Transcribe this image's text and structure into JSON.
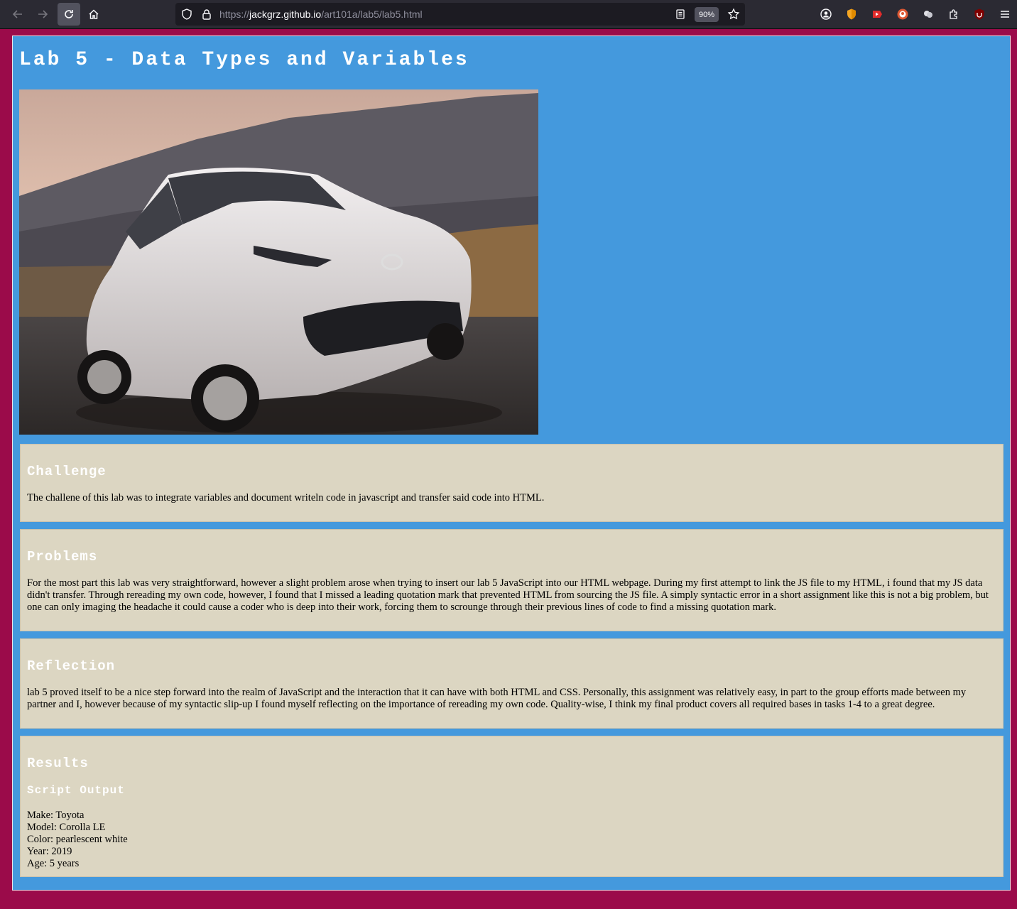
{
  "browser": {
    "url_scheme": "https://",
    "url_host": "jackgrz.github.io",
    "url_path": "/art101a/lab5/lab5.html",
    "zoom": "90%"
  },
  "page": {
    "title": "Lab 5 - Data Types and Variables",
    "image_alt": "White Toyota Corolla parked on a road with mountains at sunset",
    "sections": {
      "challenge": {
        "heading": "Challenge",
        "body": "The challene of this lab was to integrate variables and document writeln code in javascript and transfer said code into HTML."
      },
      "problems": {
        "heading": "Problems",
        "body": "For the most part this lab was very straightforward, however a slight problem arose when trying to insert our lab 5 JavaScript into our HTML webpage. During my first attempt to link the JS file to my HTML, i found that my JS data didn't transfer. Through rereading my own code, however, I found that I missed a leading quotation mark that prevented HTML from sourcing the JS file. A simply syntactic error in a short assignment like this is not a big problem, but one can only imaging the headache it could cause a coder who is deep into their work, forcing them to scrounge through their previous lines of code to find a missing quotation mark."
      },
      "reflection": {
        "heading": "Reflection",
        "body": "lab 5 proved itself to be a nice step forward into the realm of JavaScript and the interaction that it can have with both HTML and CSS. Personally, this assignment was relatively easy, in part to the group efforts made between my partner and I, however because of my syntactic slip-up I found myself reflecting on the importance of rereading my own code. Quality-wise, I think my final product covers all required bases in tasks 1-4 to a great degree."
      },
      "results": {
        "heading": "Results",
        "subheading": "Script Output",
        "lines": [
          "Make: Toyota",
          "Model: Corolla LE",
          "Color: pearlescent white",
          "Year: 2019",
          "Age: 5 years"
        ]
      }
    }
  },
  "colors": {
    "outer_background": "#9b0b4a",
    "page_background": "#4499dd",
    "section_background": "#dcd6c2",
    "heading_color": "#ffffff"
  }
}
